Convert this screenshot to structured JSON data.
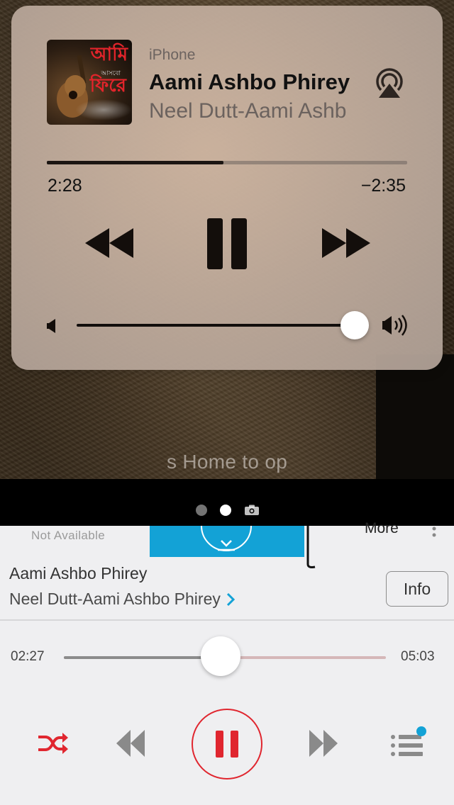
{
  "lock_screen": {
    "hint_text": "s Home to op",
    "page_indicator": {
      "pages": 2,
      "active_index": 1,
      "camera": "camera-icon"
    }
  },
  "now_playing": {
    "device": "iPhone",
    "title": "Aami Ashbo Phirey",
    "artist": "Neel Dutt-Aami Ashb",
    "artwork_text": {
      "line1": "আমি",
      "line2": "ফিরে",
      "small": "আসবো"
    },
    "elapsed": "2:28",
    "remaining": "−2:35",
    "progress": 0.49,
    "volume": 0.98,
    "icons": {
      "airplay": "airplay-icon",
      "rewind": "rewind-icon",
      "pause": "pause-icon",
      "fast_forward": "fast-forward-icon",
      "volume_min": "volume-min-icon",
      "volume_max": "volume-max-icon"
    }
  },
  "app": {
    "tab_strip": {
      "not_available": "Not Available",
      "more": "More",
      "download_icon": "download-icon"
    },
    "song": {
      "title": "Aami Ashbo Phirey",
      "artist": "Neel Dutt-Aami Ashbo Phirey",
      "info_button": "Info"
    },
    "player": {
      "elapsed": "02:27",
      "total": "05:03",
      "progress": 0.49
    },
    "colors": {
      "accent": "#e0262f",
      "download_tab": "#13a2d6",
      "queue_badge": "#13a2d6"
    }
  }
}
